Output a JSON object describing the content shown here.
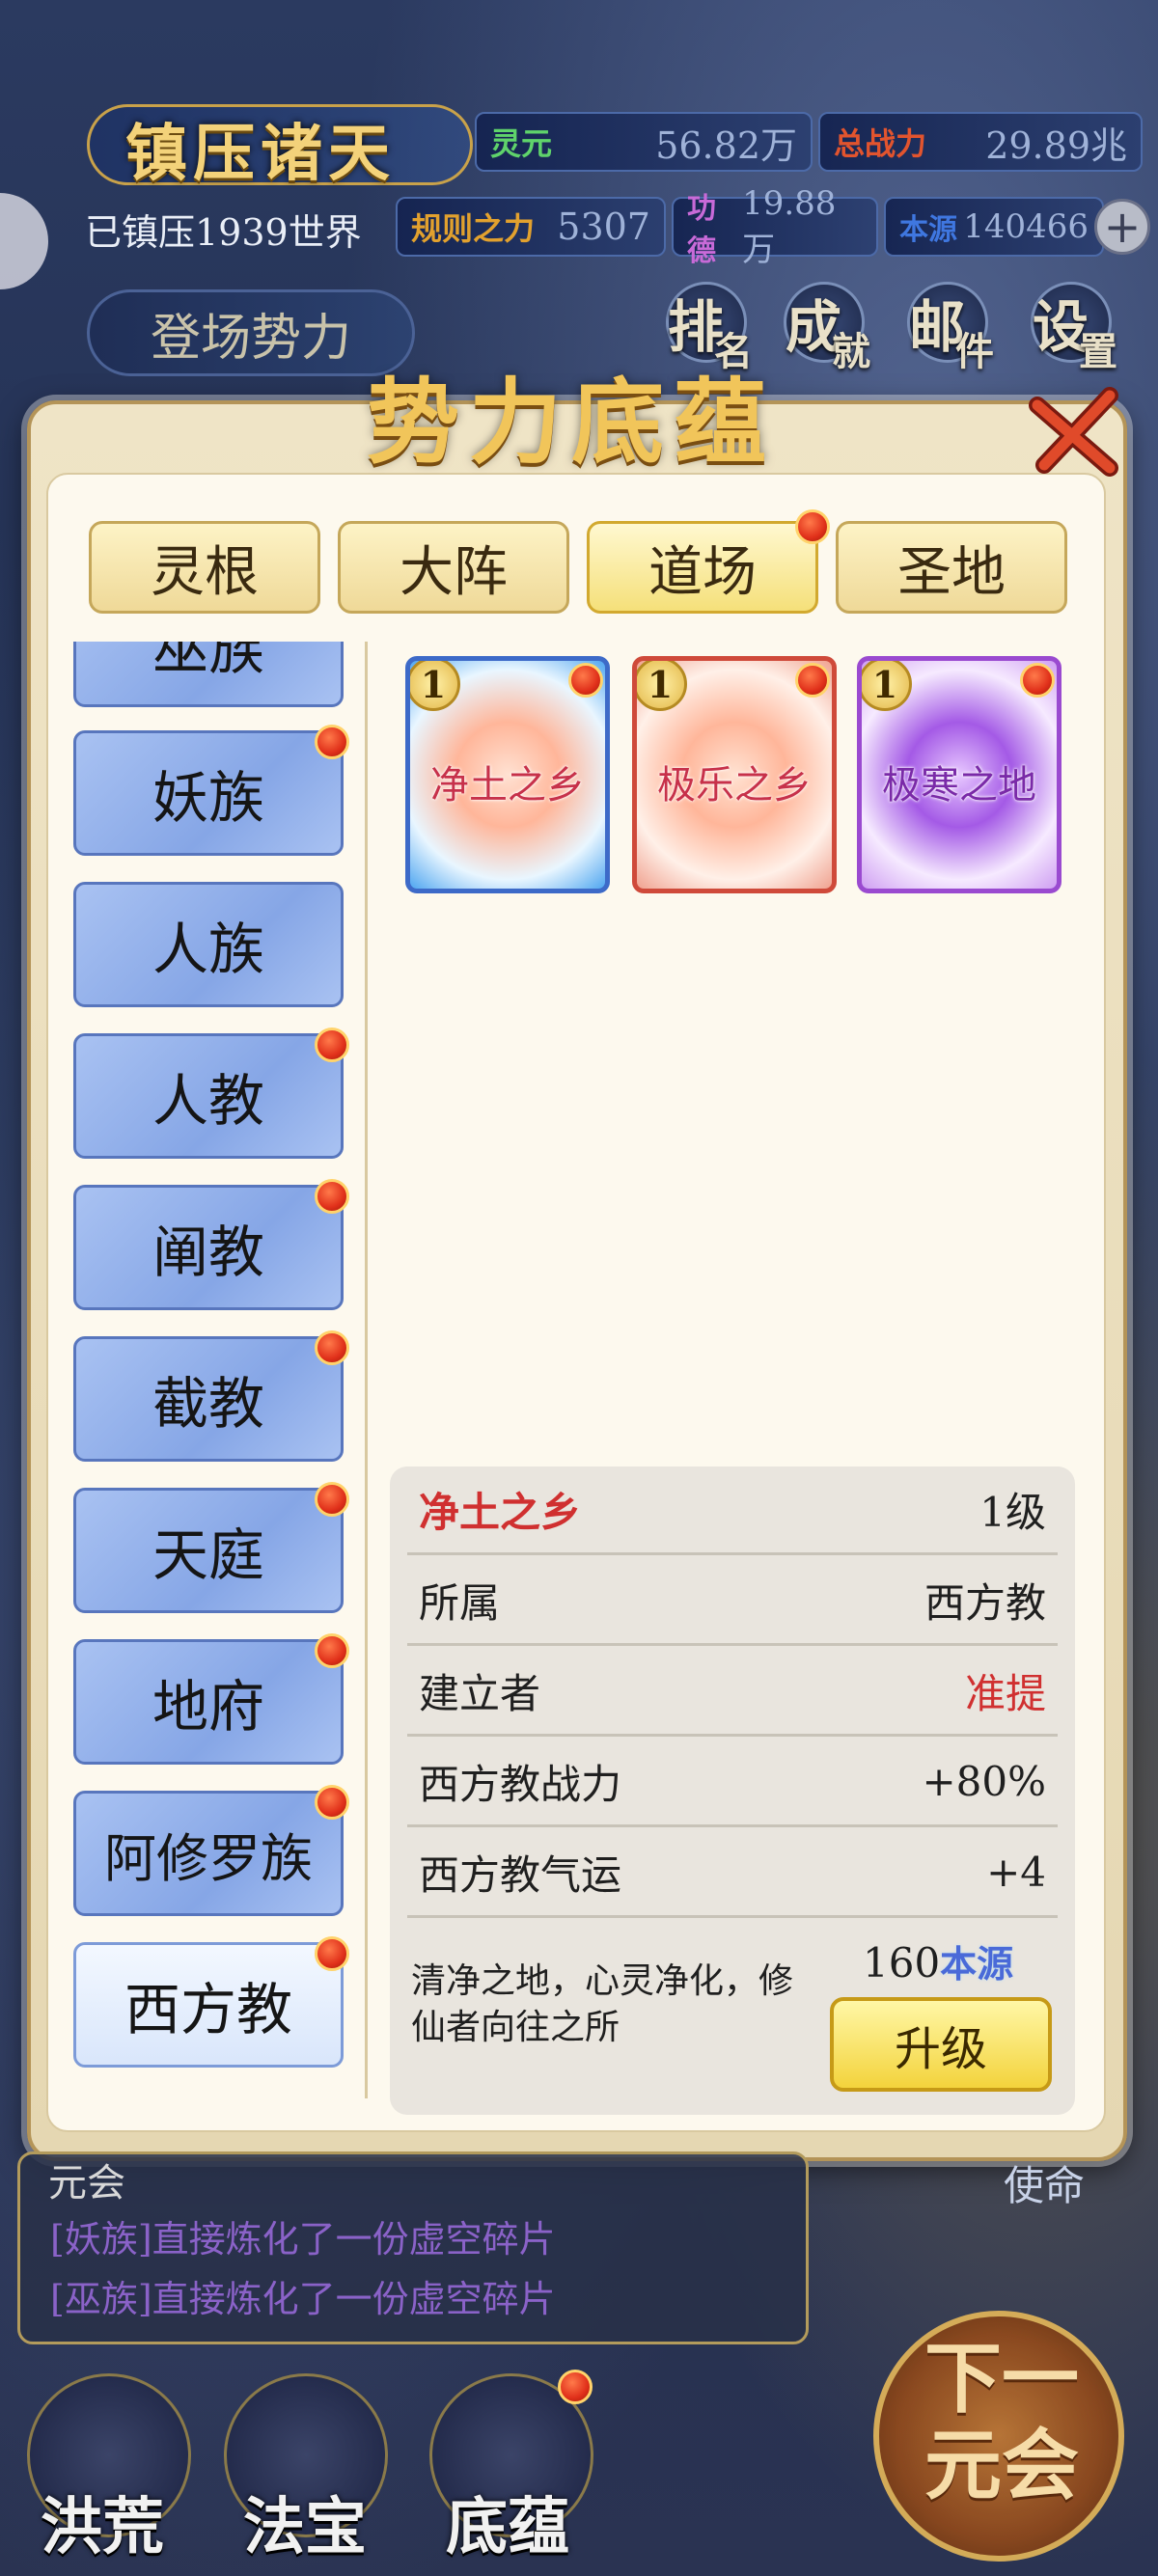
{
  "header": {
    "game_title": "镇压诸天",
    "suppressed_worlds": "已镇压1939世界",
    "stats": [
      {
        "label": "灵元",
        "value": "56.82万",
        "color": "#5fd36b"
      },
      {
        "label": "总战力",
        "value": "29.89兆",
        "color": "#e2542e"
      },
      {
        "label": "规则之力",
        "value": "5307",
        "color": "#e2a12e"
      },
      {
        "label": "功德",
        "value": "19.88万",
        "color": "#c86ad8"
      },
      {
        "label": "本源",
        "value": "140466",
        "color": "#3f77e0"
      }
    ],
    "debut_forces": "登场势力",
    "menu": [
      {
        "main": "排",
        "sub": "名"
      },
      {
        "main": "成",
        "sub": "就"
      },
      {
        "main": "邮",
        "sub": "件"
      },
      {
        "main": "设",
        "sub": "置"
      }
    ]
  },
  "modal": {
    "title": "势力底蕴",
    "tabs": [
      "灵根",
      "大阵",
      "道场",
      "圣地"
    ],
    "active_tab": "道场",
    "factions": [
      "巫族",
      "妖族",
      "人族",
      "人教",
      "阐教",
      "截教",
      "天庭",
      "地府",
      "阿修罗族",
      "西方教"
    ],
    "active_faction": "西方教",
    "cards": [
      {
        "name": "净土之乡",
        "level": "1",
        "style": "blue"
      },
      {
        "name": "极乐之乡",
        "level": "1",
        "style": "red"
      },
      {
        "name": "极寒之地",
        "level": "1",
        "style": "purple"
      }
    ],
    "detail": {
      "name": "净土之乡",
      "level": "1级",
      "rows": [
        {
          "label": "所属",
          "value": "西方教"
        },
        {
          "label": "建立者",
          "value": "准提"
        },
        {
          "label": "西方教战力",
          "value": "+80%"
        },
        {
          "label": "西方教气运",
          "value": "+4"
        }
      ],
      "description": "清净之地，心灵净化，修仙者向往之所",
      "cost_amount": "160",
      "cost_unit": "本源",
      "upgrade_label": "升级"
    }
  },
  "log": {
    "header": "元会",
    "lines": [
      "[妖族]直接炼化了一份虚空碎片",
      "[巫族]直接炼化了一份虚空碎片"
    ],
    "mission": "使命"
  },
  "bottom_nav": [
    "洪荒",
    "法宝",
    "底蕴"
  ],
  "next_button": "下一元会"
}
